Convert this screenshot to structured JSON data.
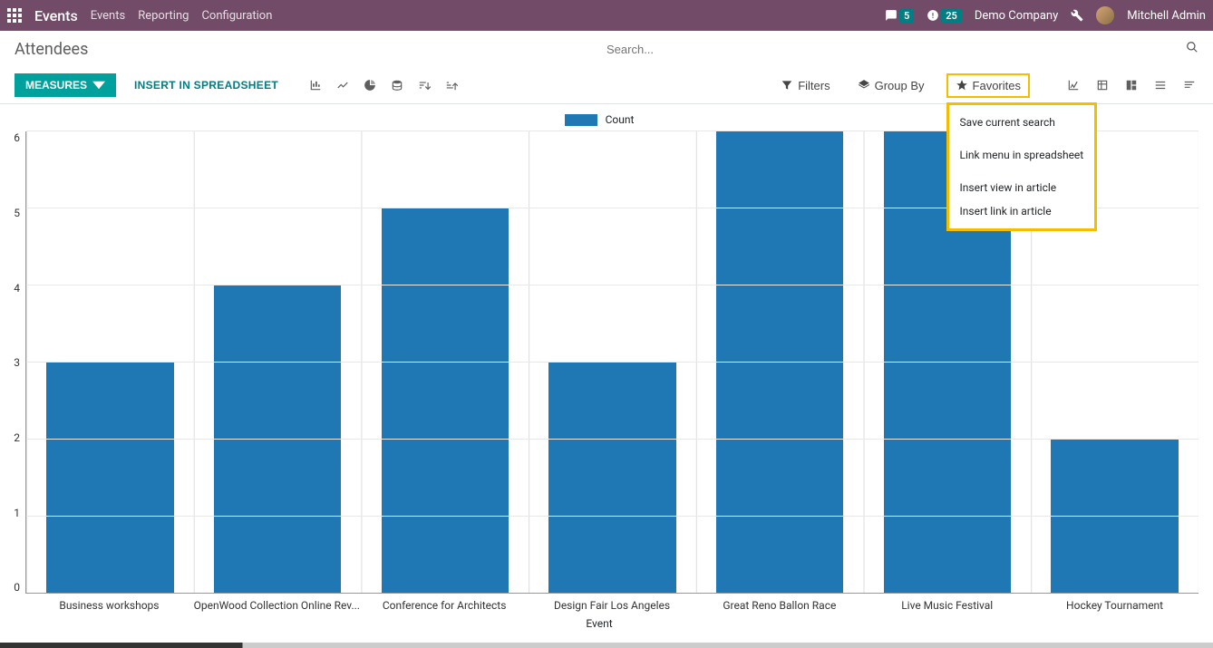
{
  "navbar": {
    "brand": "Events",
    "links": [
      "Events",
      "Reporting",
      "Configuration"
    ],
    "messages_badge": "5",
    "activities_badge": "25",
    "company": "Demo Company",
    "user": "Mitchell Admin"
  },
  "breadcrumb": "Attendees",
  "search": {
    "placeholder": "Search..."
  },
  "toolbar": {
    "measures": "MEASURES",
    "insert_spreadsheet": "INSERT IN SPREADSHEET"
  },
  "filters": {
    "filters": "Filters",
    "group_by": "Group By",
    "favorites": "Favorites"
  },
  "favorites_menu": {
    "save": "Save current search",
    "link_spreadsheet": "Link menu in spreadsheet",
    "insert_view": "Insert view in article",
    "insert_link": "Insert link in article"
  },
  "chart_data": {
    "type": "bar",
    "title": "",
    "legend": "Count",
    "xlabel": "Event",
    "ylabel": "",
    "ylim": [
      0,
      6
    ],
    "yticks": [
      6,
      5,
      4,
      3,
      2,
      1,
      0
    ],
    "categories": [
      "Business workshops",
      "OpenWood Collection Online Rev...",
      "Conference for Architects",
      "Design Fair Los Angeles",
      "Great Reno Ballon Race",
      "Live Music Festival",
      "Hockey Tournament"
    ],
    "values": [
      3,
      4,
      5,
      3,
      6,
      6,
      2
    ]
  },
  "colors": {
    "bar": "#1f77b4",
    "primary": "#00a09d",
    "accent": "#714b67",
    "highlight": "#f5bd00"
  }
}
